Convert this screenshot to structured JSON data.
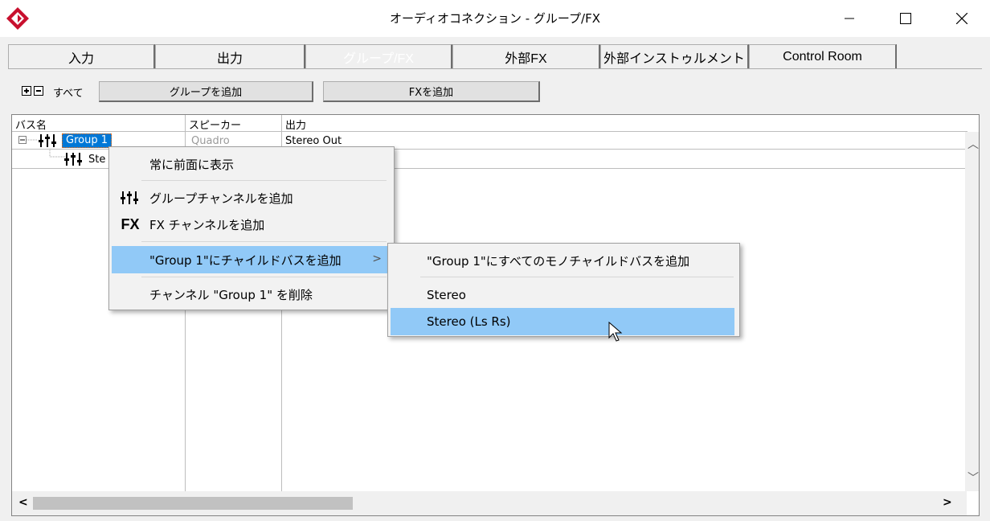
{
  "window": {
    "title": "オーディオコネクション - グループ/FX"
  },
  "tabs": [
    {
      "label": "入力"
    },
    {
      "label": "出力"
    },
    {
      "label": "グループ/FX"
    },
    {
      "label": "外部FX"
    },
    {
      "label": "外部インストゥルメント"
    },
    {
      "label": "Control Room"
    }
  ],
  "toolbar": {
    "all_label": "すべて",
    "add_group_label": "グループを追加",
    "add_fx_label": "FXを追加"
  },
  "tree": {
    "columns": [
      "バス名",
      "スピーカー",
      "出力"
    ],
    "rows": [
      {
        "name": "Group 1",
        "speaker": "Quadro",
        "output": "Stereo Out"
      },
      {
        "name": "Ste",
        "speaker": "",
        "output": ""
      }
    ]
  },
  "context_menu": {
    "items": [
      {
        "label": "常に前面に表示",
        "icon": ""
      },
      {
        "label": "グループチャンネルを追加",
        "icon": "group-channel-icon"
      },
      {
        "label": "FX チャンネルを追加",
        "icon": "fx-icon",
        "icon_text": "FX"
      },
      {
        "label": "\"Group 1\"にチャイルドバスを追加",
        "icon": "",
        "highlighted": true,
        "has_submenu": true
      },
      {
        "label": "チャンネル \"Group 1\" を削除",
        "icon": ""
      }
    ]
  },
  "submenu": {
    "items": [
      {
        "label": "\"Group 1\"にすべてのモノチャイルドバスを追加"
      },
      {
        "label": "Stereo"
      },
      {
        "label": "Stereo (Ls Rs)",
        "highlighted": true
      }
    ]
  },
  "colors": {
    "selection": "#0078d7",
    "menu_highlight": "#91c9f7",
    "logo_red": "#c8102e"
  }
}
